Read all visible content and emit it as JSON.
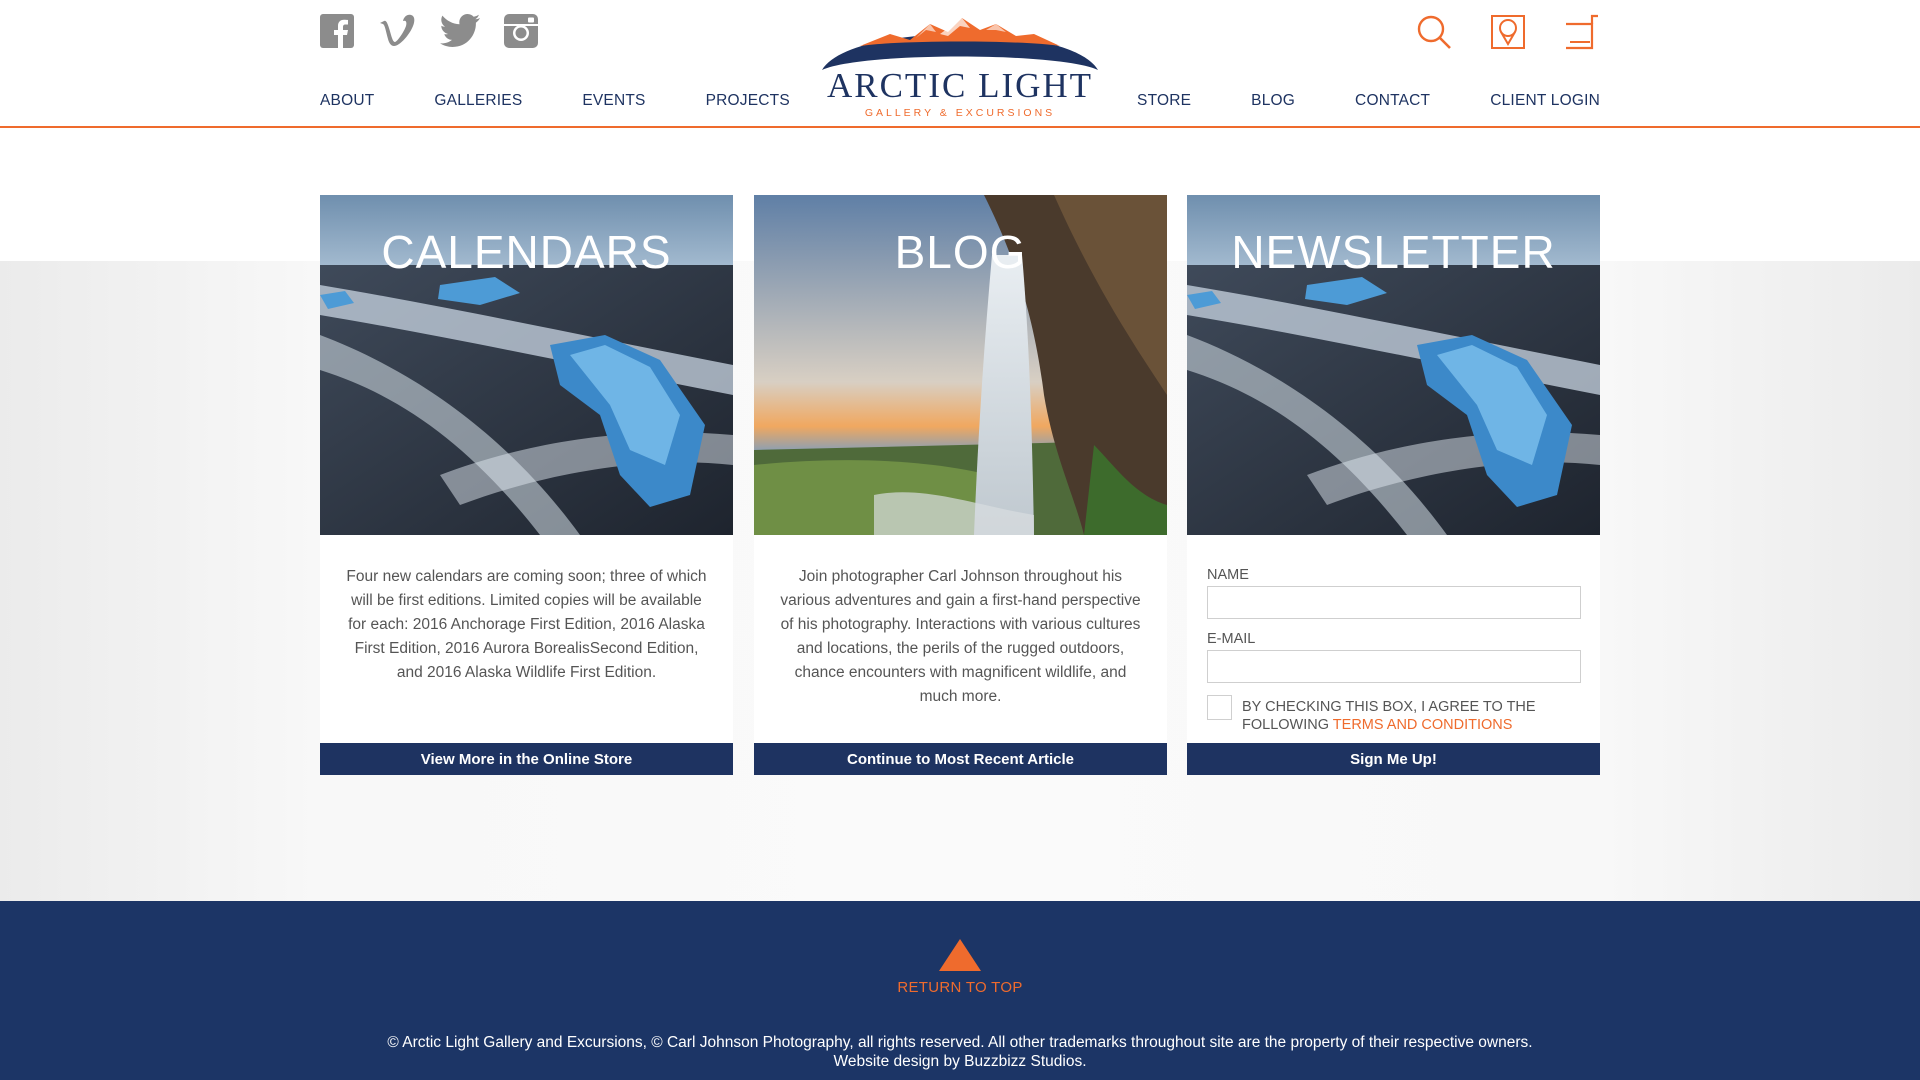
{
  "social": [
    "facebook-icon",
    "vimeo-icon",
    "twitter-icon",
    "instagram-icon"
  ],
  "utility": [
    "search-icon",
    "map-icon",
    "cart-icon"
  ],
  "logo": {
    "title": "ARCTIC LIGHT",
    "subtitle": "GALLERY & EXCURSIONS"
  },
  "nav": {
    "left": [
      "ABOUT",
      "GALLERIES",
      "EVENTS",
      "PROJECTS"
    ],
    "right": [
      "STORE",
      "BLOG",
      "CONTACT",
      "CLIENT LOGIN"
    ]
  },
  "cards": {
    "calendars": {
      "title": "CALENDARS",
      "text": "Four new calendars are coming soon; three of which will be first editions. Limited copies will be available for each: 2016 Anchorage First Edition, 2016 Alaska First Edition, 2016 Aurora BorealisSecond Edition, and 2016 Alaska Wildlife First Edition.",
      "button": "View More in the Online Store"
    },
    "blog": {
      "title": "BLOG",
      "text": "Join photographer Carl Johnson throughout his various adventures and gain a first-hand perspective of his photography. Interactions with various cultures and locations, the perils of the rugged outdoors, chance encounters with magnificent wildlife, and much more.",
      "button": "Continue to Most Recent Article"
    },
    "newsletter": {
      "title": "NEWSLETTER",
      "name_label": "NAME",
      "email_label": "E-MAIL",
      "agree_text": "BY CHECKING THIS BOX, I AGREE TO THE FOLLOWING",
      "terms_link": "TERMS AND CONDITIONS",
      "button": "Sign Me Up!"
    }
  },
  "footer": {
    "return_label": "RETURN TO TOP",
    "copyright_line1": "© Arctic Light Gallery and Excursions, © Carl Johnson Photography, all rights reserved. All other trademarks throughout site are the property of their respective owners.",
    "copyright_line2": "Website design by Buzzbizz Studios."
  },
  "colors": {
    "navy": "#1e3361",
    "orange": "#ef6b2d",
    "footer": "#1c3566",
    "icon_gray": "#8c8c8c"
  }
}
